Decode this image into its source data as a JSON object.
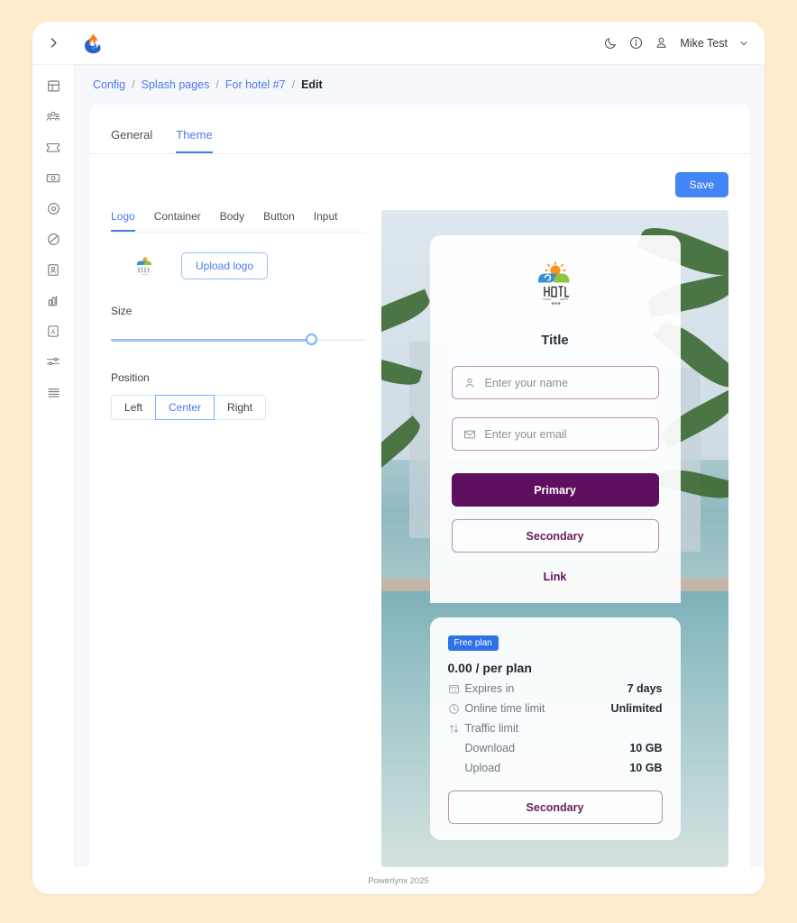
{
  "window": {
    "brand_icon": "flame-logo-icon",
    "sidebar_toggle_icon": "chevron-right-icon"
  },
  "topbar": {
    "dark_mode_icon": "moon-icon",
    "info_icon": "info-circle-icon",
    "account_icon": "person-icon",
    "user_name": "Mike Test",
    "user_chevron_icon": "chevron-down-icon"
  },
  "sidebar": {
    "items": [
      {
        "icon": "dashboard-icon",
        "name": "dashboard"
      },
      {
        "icon": "users-icon",
        "name": "users"
      },
      {
        "icon": "ticket-icon",
        "name": "vouchers"
      },
      {
        "icon": "billing-icon",
        "name": "billing"
      },
      {
        "icon": "location-pin-icon",
        "name": "locations"
      },
      {
        "icon": "block-icon",
        "name": "blocked"
      },
      {
        "icon": "id-card-icon",
        "name": "identity"
      },
      {
        "icon": "bar-chart-icon",
        "name": "reports"
      },
      {
        "icon": "text-box-icon",
        "name": "content"
      },
      {
        "icon": "sliders-icon",
        "name": "config"
      },
      {
        "icon": "list-icon",
        "name": "logs"
      }
    ]
  },
  "breadcrumb": {
    "items": [
      "Config",
      "Splash pages",
      "For hotel #7"
    ],
    "current": "Edit",
    "separator": "/"
  },
  "tabs": [
    {
      "label": "General",
      "active": false
    },
    {
      "label": "Theme",
      "active": true
    }
  ],
  "toolbar": {
    "save_label": "Save"
  },
  "subtabs": [
    {
      "label": "Logo",
      "active": true
    },
    {
      "label": "Container",
      "active": false
    },
    {
      "label": "Body",
      "active": false
    },
    {
      "label": "Button",
      "active": false
    },
    {
      "label": "Input",
      "active": false
    }
  ],
  "logo_panel": {
    "thumbnail_icon": "hotel-logo-thumbnail",
    "upload_label": "Upload logo",
    "size_label": "Size",
    "size_percent": 79,
    "position_label": "Position",
    "position_options": [
      {
        "label": "Left",
        "active": false
      },
      {
        "label": "Center",
        "active": true
      },
      {
        "label": "Right",
        "active": false
      }
    ]
  },
  "preview": {
    "logo_icon": "hotel-sun-logo",
    "logo_text": "HOTEL",
    "title": "Title",
    "name_field": {
      "icon": "person-icon",
      "placeholder": "Enter your name",
      "value": ""
    },
    "email_field": {
      "icon": "envelope-icon",
      "placeholder": "Enter your email",
      "value": ""
    },
    "primary_button": "Primary",
    "secondary_button": "Secondary",
    "link_button": "Link",
    "plan": {
      "badge": "Free plan",
      "price": "0.00 / per plan",
      "rows": [
        {
          "icon": "calendar-icon",
          "label": "Expires in",
          "value": "7 days",
          "indent": false
        },
        {
          "icon": "clock-icon",
          "label": "Online time limit",
          "value": "Unlimited",
          "indent": false
        },
        {
          "icon": "transfer-icon",
          "label": "Traffic limit",
          "value": "",
          "indent": false
        },
        {
          "icon": "",
          "label": "Download",
          "value": "10 GB",
          "indent": true
        },
        {
          "icon": "",
          "label": "Upload",
          "value": "10 GB",
          "indent": true
        }
      ],
      "button": "Secondary"
    }
  },
  "footer": {
    "text": "Powerlynx 2025"
  },
  "colors": {
    "page_background": "#fdeccd",
    "accent_blue": "#4285f4",
    "link_blue": "#4b7bec",
    "theme_purple": "#5f0f5f",
    "theme_purple_border": "#b98fb4",
    "badge_blue": "#2f72e8",
    "content_background": "#f5f7fb"
  }
}
